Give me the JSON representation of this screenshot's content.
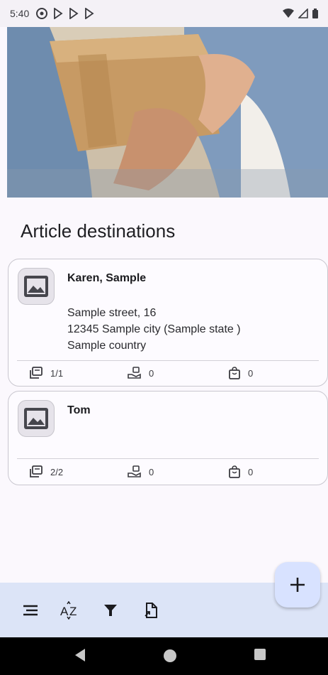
{
  "status_bar": {
    "time": "5:40",
    "left_icons": [
      "at-sign-icon",
      "play-store-icon",
      "play-store-icon",
      "play-store-icon"
    ],
    "right_icons": [
      "wifi-icon",
      "signal-icon",
      "battery-icon"
    ]
  },
  "header": {
    "title": "Article destinations"
  },
  "destinations": [
    {
      "name": "Karen, Sample",
      "address_line1": "Sample street, 16",
      "address_line2": "12345 Sample city (Sample state )",
      "address_line3": "Sample country",
      "articles": "1/1",
      "delivered": "0",
      "packages": "0"
    },
    {
      "name": "Tom",
      "articles": "2/2",
      "delivered": "0",
      "packages": "0"
    }
  ],
  "bottom_bar": {
    "icons": [
      "menu-icon",
      "sort-az-icon",
      "filter-icon",
      "export-icon"
    ]
  },
  "fab": {
    "icon": "add-icon",
    "label": "+"
  },
  "colors": {
    "background": "#fbf8fd",
    "card_border": "#c9c7cf",
    "bottom_bar": "#dce4f7",
    "fab": "#d8e2ff"
  }
}
